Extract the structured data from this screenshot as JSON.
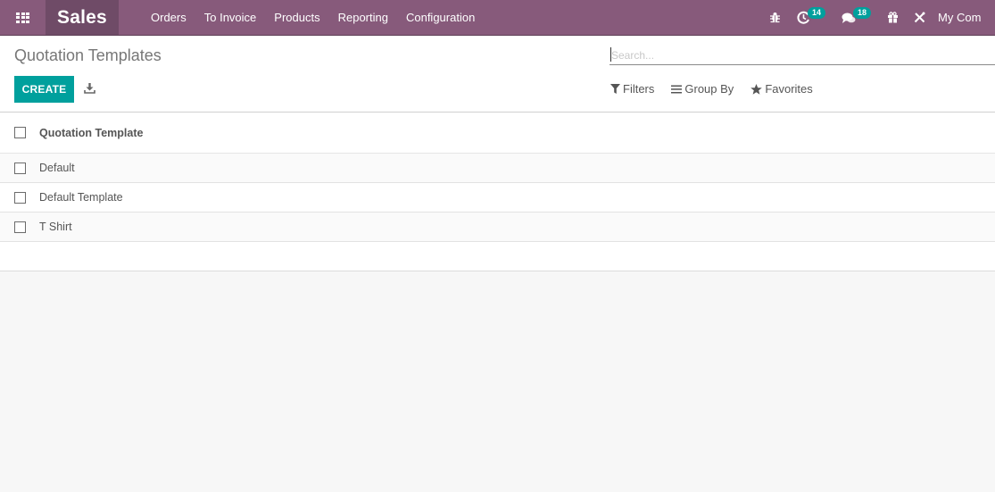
{
  "navbar": {
    "app_name": "Sales",
    "menu": [
      {
        "label": "Orders"
      },
      {
        "label": "To Invoice"
      },
      {
        "label": "Products"
      },
      {
        "label": "Reporting"
      },
      {
        "label": "Configuration"
      }
    ],
    "systray": {
      "debug_icon": "bug-icon",
      "activity_icon": "clock-icon",
      "activity_count": "14",
      "messages_icon": "comments-icon",
      "messages_count": "18",
      "gift_icon": "gift-icon",
      "tools_icon": "tools-icon",
      "company": "My Com"
    },
    "brand_color": "#875a7b"
  },
  "control_panel": {
    "title": "Quotation Templates",
    "create_label": "CREATE",
    "download_icon": "download-icon",
    "search": {
      "value": "",
      "placeholder": "Search..."
    },
    "filters": [
      {
        "icon": "filter-icon",
        "label": "Filters"
      },
      {
        "icon": "bars-icon",
        "label": "Group By"
      },
      {
        "icon": "star-icon",
        "label": "Favorites"
      }
    ],
    "accent_color": "#00a09d"
  },
  "list": {
    "columns": [
      {
        "label": "Quotation Template"
      }
    ],
    "rows": [
      {
        "name": "Default"
      },
      {
        "name": "Default Template"
      },
      {
        "name": "T Shirt"
      }
    ]
  }
}
